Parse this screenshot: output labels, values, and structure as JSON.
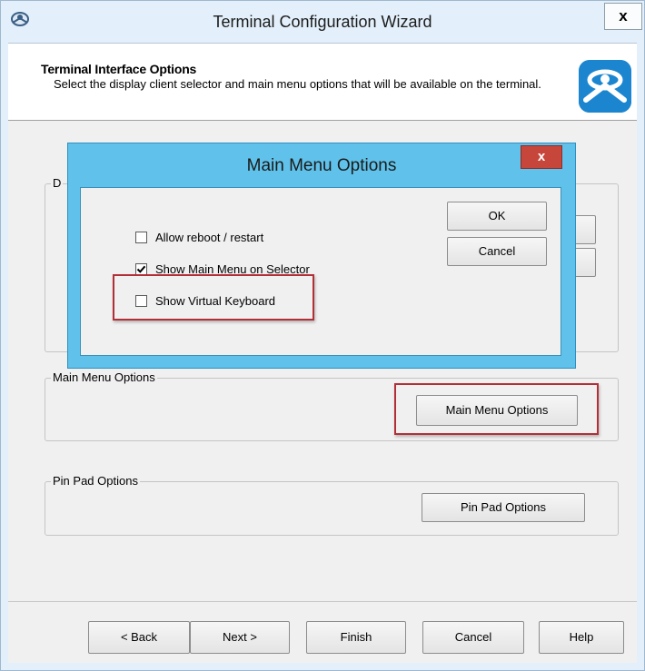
{
  "window": {
    "title": "Terminal Configuration Wizard",
    "close_label": "x"
  },
  "header": {
    "title": "Terminal Interface Options",
    "description": "Select the display client selector and main menu options that will be available on the terminal."
  },
  "groups": {
    "display_partial_label": "D",
    "main_menu": {
      "label": "Main Menu Options",
      "button_label": "Main Menu Options"
    },
    "pin_pad": {
      "label": "Pin Pad Options",
      "button_label": "Pin Pad Options"
    }
  },
  "footer": {
    "back_label": "< Back",
    "next_label": "Next >",
    "finish_label": "Finish",
    "cancel_label": "Cancel",
    "help_label": "Help"
  },
  "modal": {
    "title": "Main Menu Options",
    "close_label": "x",
    "ok_label": "OK",
    "cancel_label": "Cancel",
    "options": [
      {
        "label": "Allow reboot / restart",
        "checked": false
      },
      {
        "label": "Show Main Menu on Selector",
        "checked": true
      },
      {
        "label": "Show Virtual Keyboard",
        "checked": false
      }
    ]
  },
  "colors": {
    "highlight": "#b22f38",
    "modal_frame": "#60c2ea",
    "modal_close": "#c7463b",
    "logo": "#1e8fd6"
  }
}
